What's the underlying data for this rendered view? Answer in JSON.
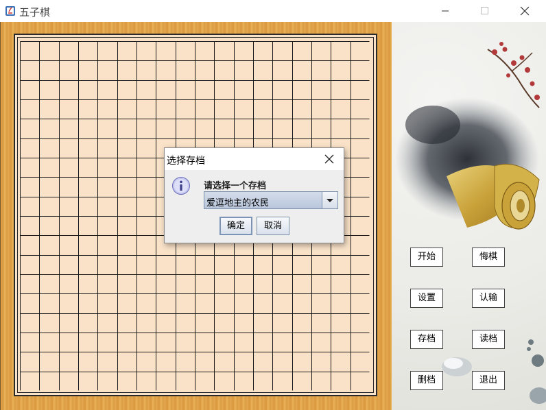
{
  "window": {
    "title": "五子棋",
    "controls": [
      "minimize",
      "maximize",
      "close"
    ]
  },
  "board": {
    "grid_size": 18
  },
  "side_buttons": [
    {
      "label": "开始",
      "name": "start-button"
    },
    {
      "label": "悔棋",
      "name": "undo-button"
    },
    {
      "label": "设置",
      "name": "settings-button"
    },
    {
      "label": "认输",
      "name": "surrender-button"
    },
    {
      "label": "存档",
      "name": "save-button"
    },
    {
      "label": "读档",
      "name": "load-button"
    },
    {
      "label": "删档",
      "name": "delete-save-button"
    },
    {
      "label": "退出",
      "name": "exit-button"
    }
  ],
  "dialog": {
    "title": "选择存档",
    "message": "请选择一个存档",
    "combo_value": "爱逗地主的农民",
    "ok_label": "确定",
    "cancel_label": "取消",
    "icon": "info-icon"
  }
}
